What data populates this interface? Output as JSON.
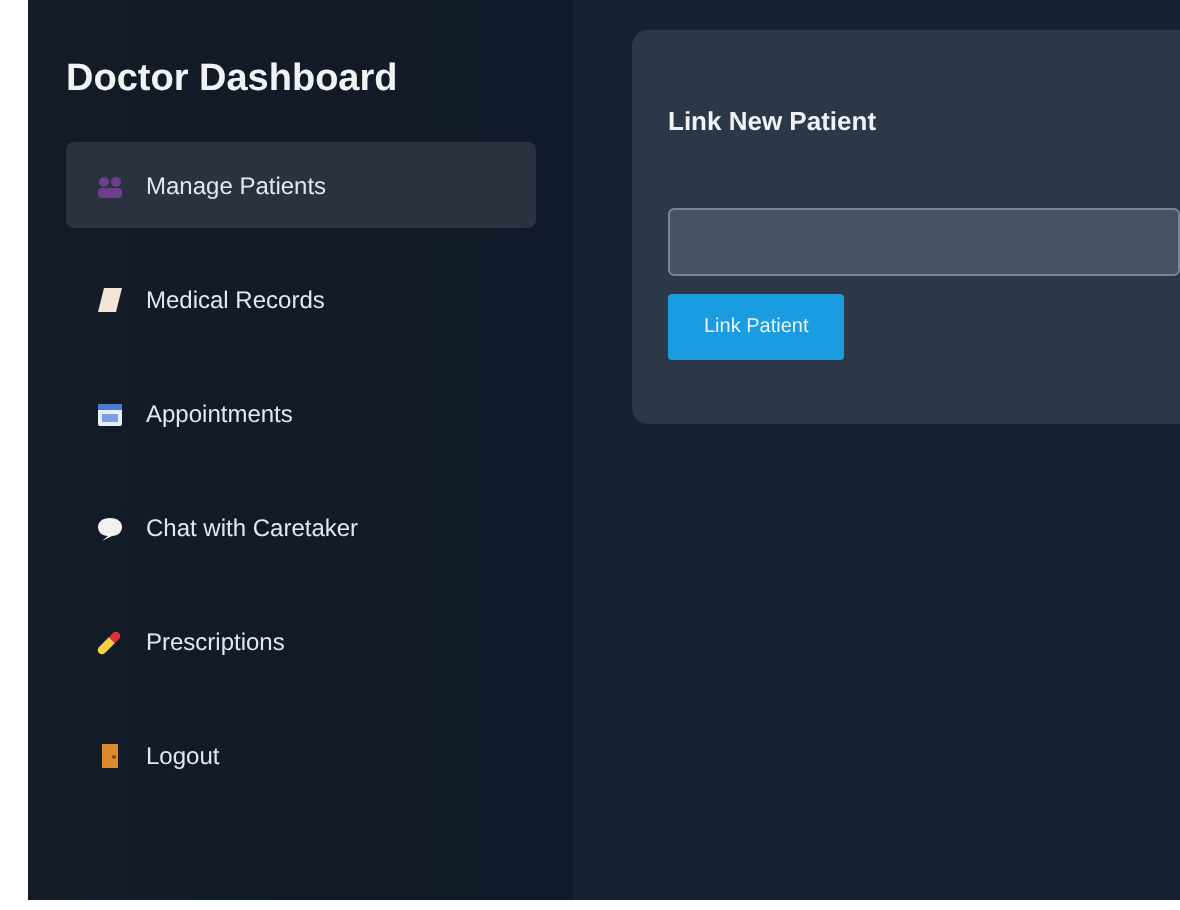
{
  "sidebar": {
    "title": "Doctor Dashboard",
    "items": [
      {
        "label": "Manage Patients",
        "selected": true
      },
      {
        "label": "Medical Records",
        "selected": false
      },
      {
        "label": "Appointments",
        "selected": false
      },
      {
        "label": "Chat with Caretaker",
        "selected": false
      },
      {
        "label": "Prescriptions",
        "selected": false
      },
      {
        "label": "Logout",
        "selected": false
      }
    ]
  },
  "card": {
    "title": "Link New Patient",
    "button": "Link Patient"
  }
}
